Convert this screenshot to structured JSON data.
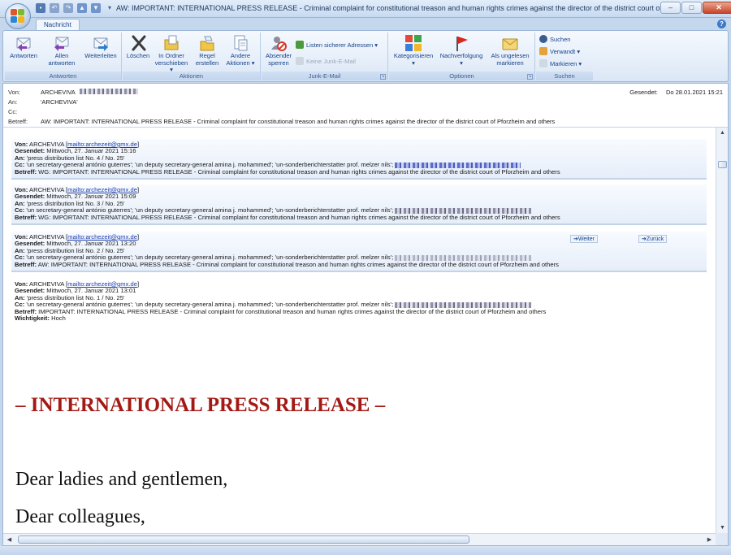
{
  "window": {
    "title": "AW: IMPORTANT: INTERNATIONAL PRESS RELEASE  -  Criminal complaint for constitutional treason and human rights crimes against the director of the district court of Pforzhe...",
    "minimize": "–",
    "maximize": "□",
    "close": "✕"
  },
  "tabs": {
    "active": "Nachricht",
    "help": "?"
  },
  "ribbon": {
    "antworten": {
      "label": "Antworten",
      "reply": "Antworten",
      "reply_all_1": "Allen",
      "reply_all_2": "antworten",
      "forward": "Weiterleiten"
    },
    "aktionen": {
      "label": "Aktionen",
      "delete": "Löschen",
      "move_1": "In Ordner",
      "move_2": "verschieben ▾",
      "rules_1": "Regel",
      "rules_2": "erstellen",
      "other_1": "Andere",
      "other_2": "Aktionen ▾"
    },
    "junk": {
      "label": "Junk-E-Mail",
      "block_1": "Absender",
      "block_2": "sperren",
      "safe_list": "Listen sicherer Adressen ▾",
      "not_junk": "Keine Junk-E-Mail"
    },
    "optionen": {
      "label": "Optionen",
      "categorize": "Kategorisieren",
      "followup": "Nachverfolgung",
      "unread_1": "Als ungelesen",
      "unread_2": "markieren"
    },
    "suchen": {
      "label": "Suchen",
      "find": "Suchen",
      "related": "Verwandt ▾",
      "select": "Markieren ▾"
    }
  },
  "header": {
    "from_label": "Von:",
    "from_value": "ARCHEVIVA",
    "to_label": "An:",
    "to_value": "'ARCHEVIVA'",
    "cc_label": "Cc:",
    "subject_label": "Betreff:",
    "subject_value": "AW: IMPORTANT:  INTERNATIONAL PRESS RELEASE  -  Criminal complaint for constitutional treason and human rights crimes against the director of the district court of Pforzheim and others",
    "sent_label": "Gesendet:",
    "sent_value": "Do 28.01.2021 15:21"
  },
  "messages": [
    {
      "from_label": "Von:",
      "from_name": "ARCHEVIVA",
      "from_link": "mailto:archezeit@gmx.de",
      "sent_label": "Gesendet:",
      "sent": "Mittwoch, 27. Januar 2021 15:16",
      "to_label": "An:",
      "to": "'press distribution list No. 4 / No. 25'",
      "cc_label": "Cc:",
      "cc": "'un secretary-general antónio guterres'; 'un deputy secretary-general amina j. mohammed'; 'un-sonderberichterstatter prof. melzer nils';",
      "subject_label": "Betreff:",
      "subject": "WG: IMPORTANT: INTERNATIONAL PRESS RELEASE - Criminal complaint for constitutional treason and human rights crimes against the director of the district court of Pforzheim and others"
    },
    {
      "from_label": "Von:",
      "from_name": "ARCHEVIVA",
      "from_link": "mailto:archezeit@gmx.de",
      "sent_label": "Gesendet:",
      "sent": "Mittwoch, 27. Januar 2021 15:09",
      "to_label": "An:",
      "to": "'press distribution list No. 3 / No. 25'",
      "cc_label": "Cc:",
      "cc": "'un secretary-general antónio guterres'; 'un deputy secretary-general amina j. mohammed'; 'un-sonderberichterstatter prof. melzer nils';",
      "subject_label": "Betreff:",
      "subject": "WG: IMPORTANT: INTERNATIONAL PRESS RELEASE - Criminal complaint for constitutional treason and human rights crimes against the director of the district court of Pforzheim and others"
    },
    {
      "from_label": "Von:",
      "from_name": "ARCHEVIVA",
      "from_link": "mailto:archezeit@gmx.de",
      "sent_label": "Gesendet:",
      "sent": "Mittwoch, 27. Januar 2021 13:20",
      "to_label": "An:",
      "to": "'press distribution list No. 2 / No. 25'",
      "cc_label": "Cc:",
      "cc": "'un secretary-general antónio guterres'; 'un deputy secretary-general amina j. mohammed'; 'un-sonderberichterstatter prof. melzer nils';",
      "subject_label": "Betreff:",
      "subject": "AW: IMPORTANT: INTERNATIONAL PRESS RELEASE - Criminal complaint for constitutional treason and human rights crimes against the director of the district court of Pforzheim and others",
      "nav_forward": "➔Weiter",
      "nav_back": "➔Zurück"
    },
    {
      "from_label": "Von:",
      "from_name": "ARCHEVIVA",
      "from_link": "mailto:archezeit@gmx.de",
      "sent_label": "Gesendet:",
      "sent": "Mittwoch, 27. Januar 2021 13:01",
      "to_label": "An:",
      "to": "'press distribution list No. 1 / No. 25'",
      "cc_label": "Cc:",
      "cc": "'un secretary-general antónio guterres'; 'un deputy secretary-general amina j. mohammed'; 'un-sonderberichterstatter prof. melzer nils';",
      "subject_label": "Betreff:",
      "subject": "IMPORTANT: INTERNATIONAL PRESS RELEASE - Criminal complaint for constitutional treason and human rights crimes against the director of the district court of Pforzheim and others",
      "importance_label": "Wichtigkeit:",
      "importance": "Hoch"
    }
  ],
  "body": {
    "press_title": "– INTERNATIONAL PRESS RELEASE –",
    "greeting_1": "Dear ladies and gentlemen,",
    "greeting_2": "Dear colleagues,"
  },
  "colors": {
    "accent": "#15428b",
    "press_title": "#a31914",
    "ribbon_bg": "#dbe7f6"
  },
  "icons": [
    "office-button-icon",
    "save-icon",
    "undo-icon",
    "redo-icon",
    "up-icon",
    "down-icon",
    "reply-icon",
    "reply-all-icon",
    "forward-icon",
    "delete-icon",
    "move-folder-icon",
    "rule-icon",
    "other-actions-icon",
    "block-sender-icon",
    "safe-list-icon",
    "not-junk-icon",
    "categorize-icon",
    "flag-icon",
    "unread-envelope-icon",
    "binoculars-icon",
    "related-icon",
    "select-icon",
    "help-icon"
  ]
}
